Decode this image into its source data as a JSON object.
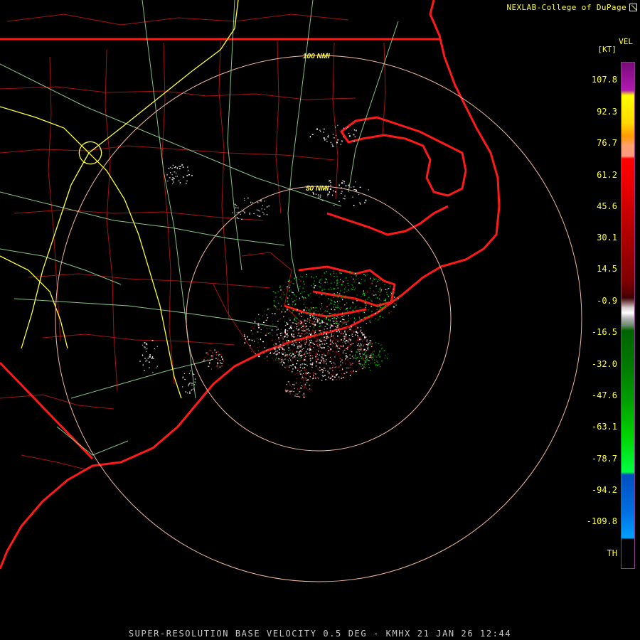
{
  "credit": {
    "text": "NEXLAB-College of DuPage",
    "logo_icon": "cod-logo-icon"
  },
  "product": {
    "footer_text": "SUPER-RESOLUTION BASE VELOCITY 0.5 DEG - KMHX 21 JAN 26 12:44"
  },
  "map": {
    "range_rings": [
      {
        "label": "50 NMI"
      },
      {
        "label": "100 NMI"
      }
    ],
    "colors": {
      "state_borders": "#ff1a1a",
      "county_borders": "#cc1a1a",
      "interstates": "#ffff3c",
      "highways": "#9fe69f",
      "range_rings": "#f0b8a0"
    }
  },
  "scale": {
    "title": "VEL",
    "unit": "[KT]",
    "labels": [
      "107.8",
      "92.3",
      "76.7",
      "61.2",
      "45.6",
      "30.1",
      "14.5",
      "-0.9",
      "-16.5",
      "-32.0",
      "-47.6",
      "-63.1",
      "-78.7",
      "-94.2",
      "-109.8",
      "TH"
    ]
  }
}
